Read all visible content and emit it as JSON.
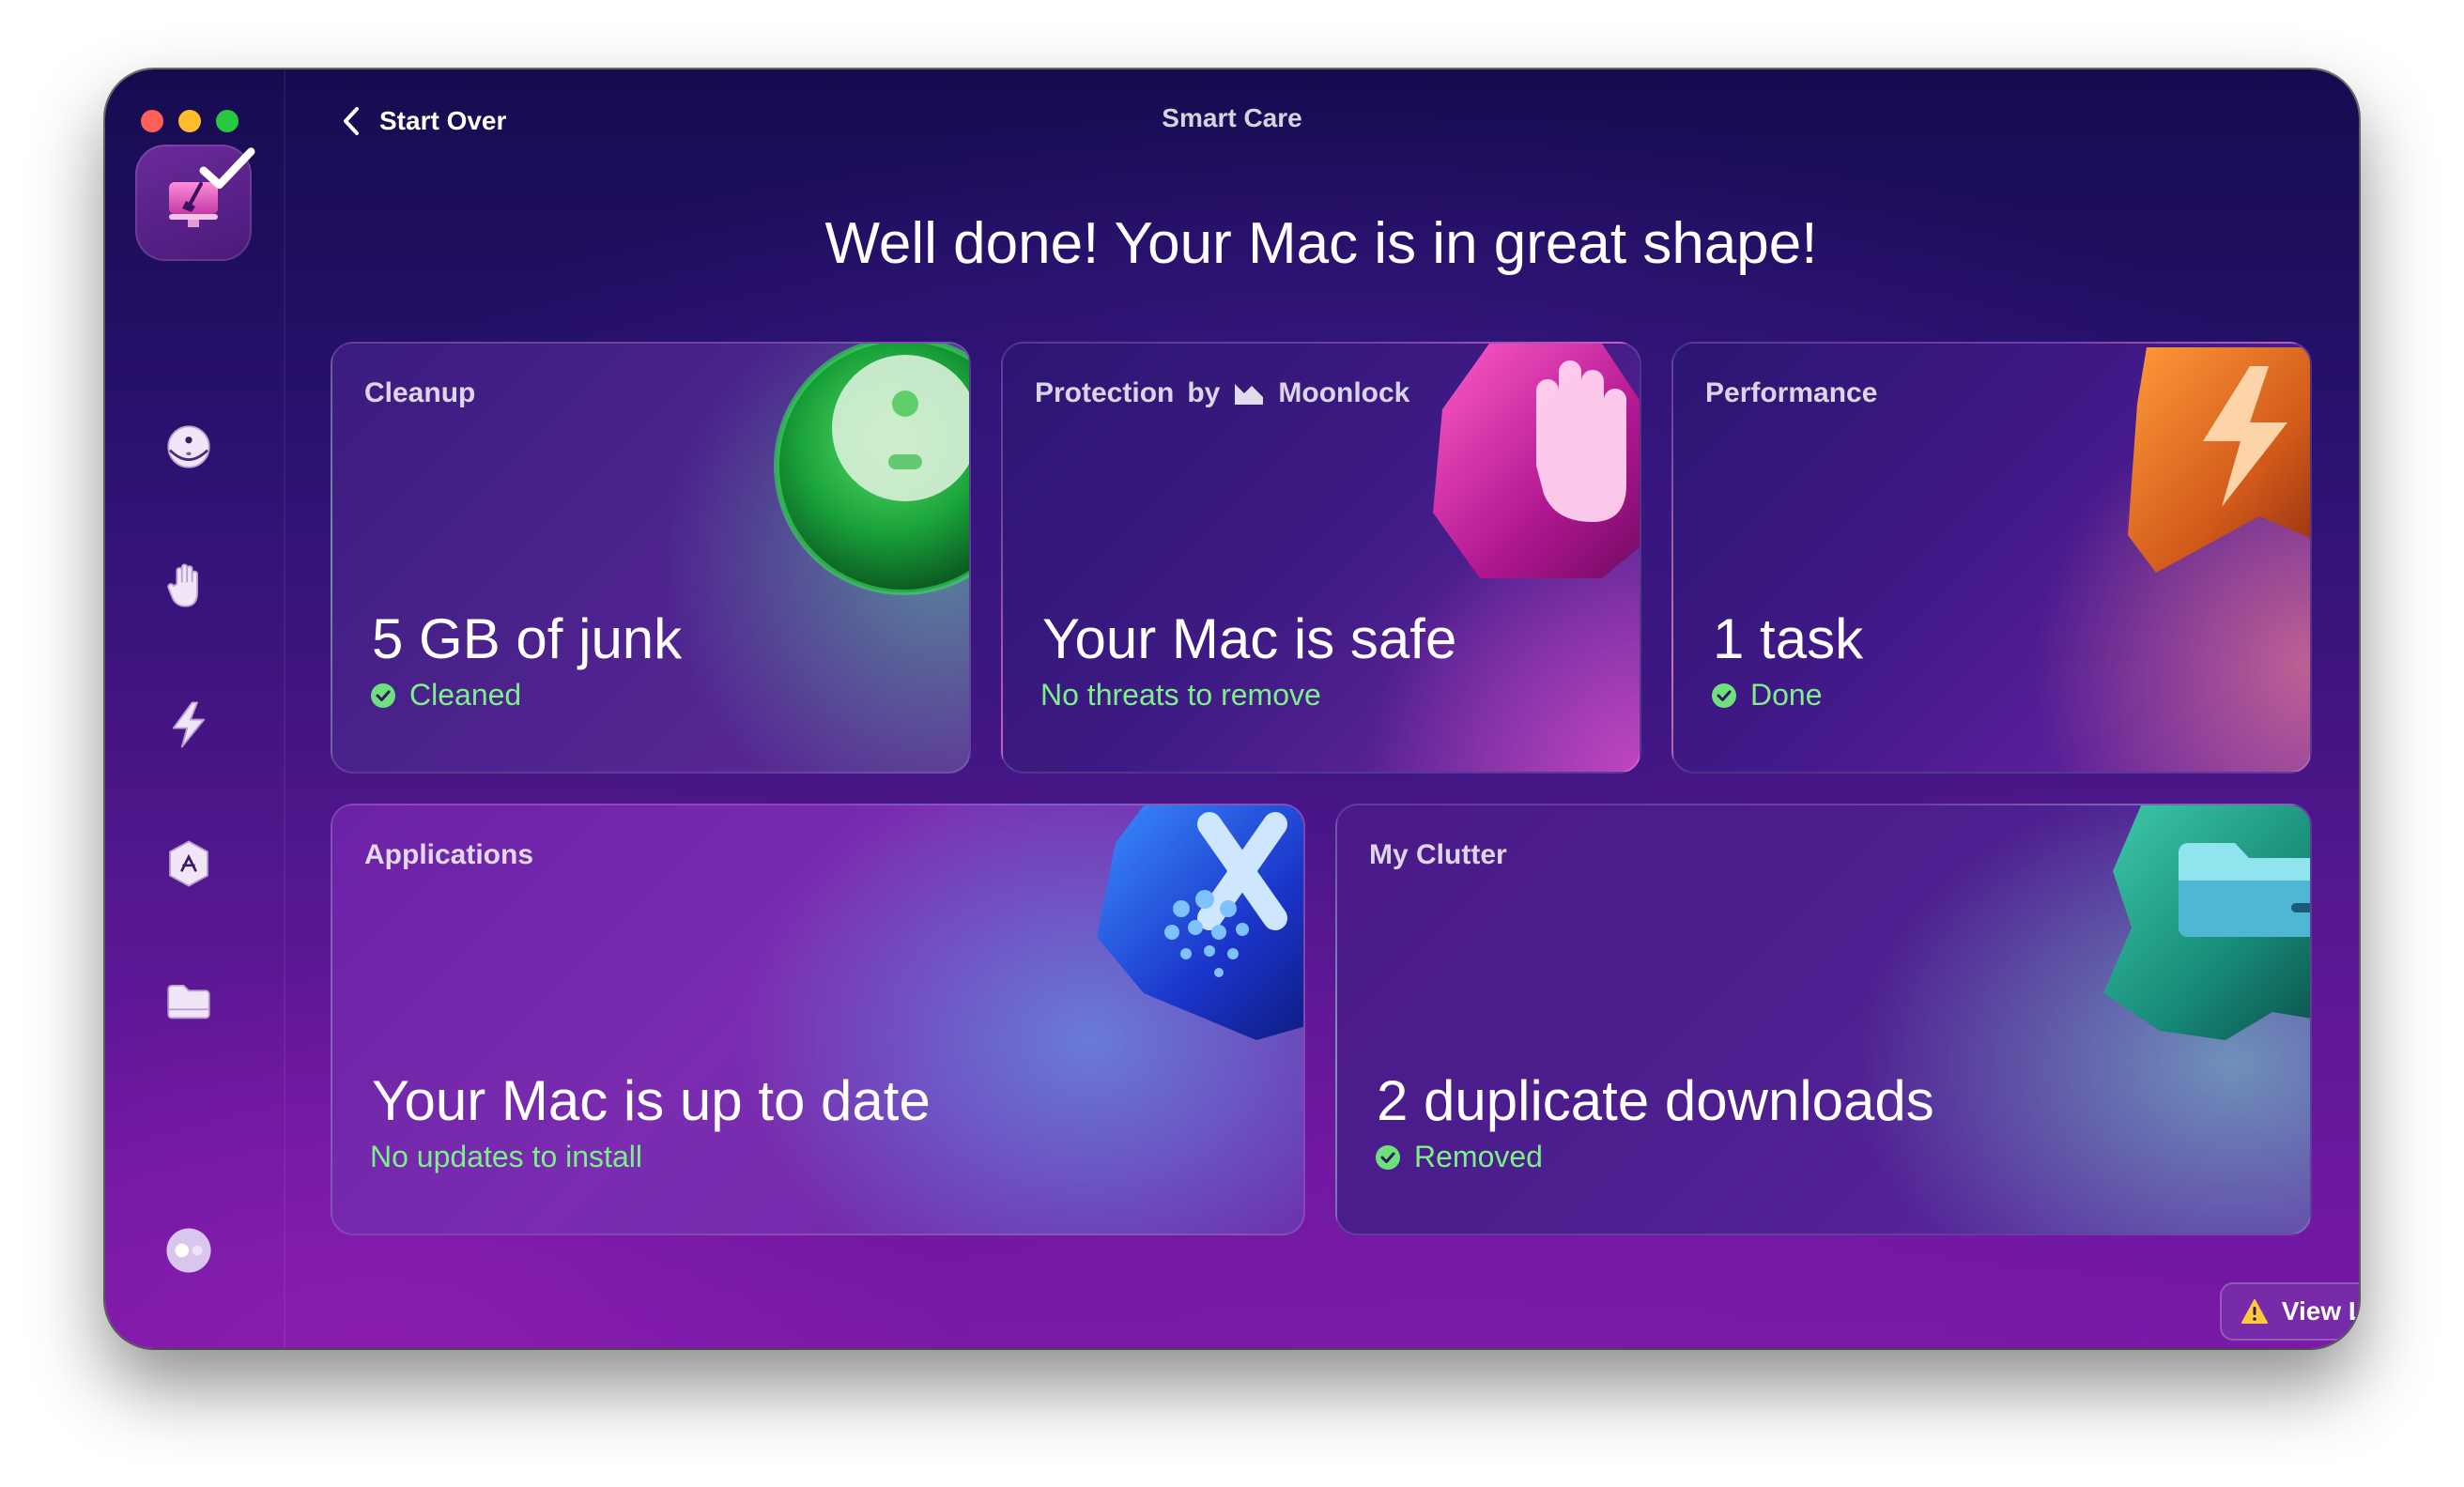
{
  "window": {
    "title": "Smart Care",
    "traffic_lights": [
      "close",
      "minimize",
      "zoom"
    ]
  },
  "toolbar": {
    "back_label": "Start Over",
    "back_icon": "chevron-left-icon"
  },
  "sidebar": {
    "items": [
      {
        "name": "smart-care",
        "icon": "display-broom-icon",
        "active": true,
        "completed": true
      },
      {
        "name": "cleanup",
        "icon": "disc-icon"
      },
      {
        "name": "protection",
        "icon": "hand-icon"
      },
      {
        "name": "performance",
        "icon": "lightning-icon"
      },
      {
        "name": "applications",
        "icon": "app-hexagon-icon"
      },
      {
        "name": "my-clutter",
        "icon": "folder-icon"
      }
    ],
    "footer_icon": "assistant-orb-icon"
  },
  "main": {
    "heading": "Well done! Your Mac is in great shape!",
    "cards": [
      {
        "label": "Cleanup",
        "title": "5 GB of junk",
        "status": "Cleaned",
        "status_icon": "check-circle-icon",
        "art": "green-disc"
      },
      {
        "label_prefix": "Protection",
        "label_by": "by",
        "label_brand": "Moonlock",
        "title": "Your Mac is safe",
        "status": "No threats to remove",
        "art": "pink-hand-hexagon"
      },
      {
        "label": "Performance",
        "title": "1 task",
        "status": "Done",
        "status_icon": "check-circle-icon",
        "art": "orange-lightning"
      },
      {
        "label": "Applications",
        "title": "Your Mac is up to date",
        "status": "No updates to install",
        "art": "blue-app-hexagon"
      },
      {
        "label": "My Clutter",
        "title": "2 duplicate downloads",
        "status": "Removed",
        "status_icon": "check-circle-icon",
        "art": "teal-folder"
      }
    ]
  },
  "footer": {
    "view_log_label": "View Log",
    "view_log_icon": "warning-triangle-icon"
  },
  "colors": {
    "status_green": "#7ef08a",
    "window_top": "#160b4f",
    "window_bottom": "#7a18a8",
    "warning": "#ffc83d"
  }
}
